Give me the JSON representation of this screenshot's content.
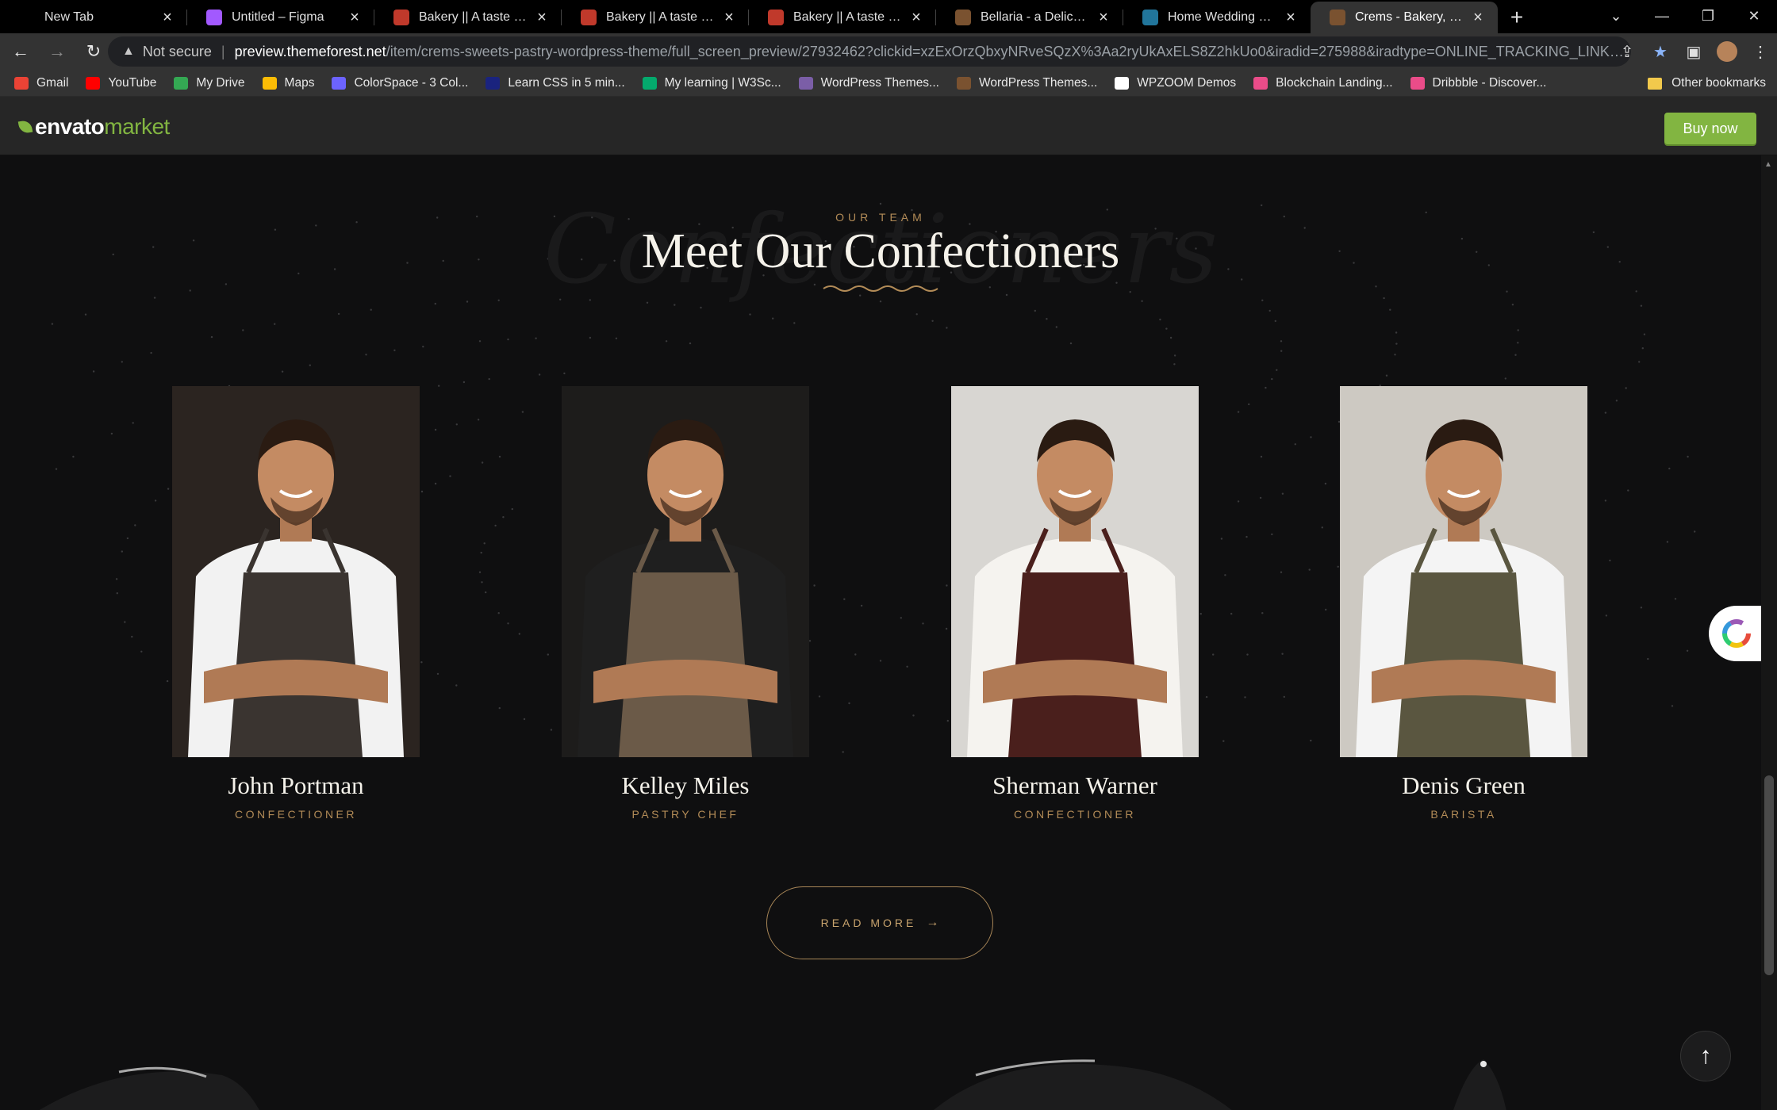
{
  "browser": {
    "tabs": [
      {
        "title": "New Tab",
        "icon": "chrome-icon",
        "color": "#000000"
      },
      {
        "title": "Untitled – Figma",
        "icon": "figma-icon",
        "color": "#a259ff"
      },
      {
        "title": "Bakery || A taste of paradise",
        "icon": "cake-icon",
        "color": "#c0392b"
      },
      {
        "title": "Bakery || A taste of paradise",
        "icon": "cake-icon",
        "color": "#c0392b"
      },
      {
        "title": "Bakery || A taste of paradise",
        "icon": "cake-icon",
        "color": "#c0392b"
      },
      {
        "title": "Bellaria - a Delicious Cake",
        "icon": "bellaria-icon",
        "color": "#7a5230"
      },
      {
        "title": "Home Wedding – Bellaria",
        "icon": "wordpress-icon",
        "color": "#21759b"
      },
      {
        "title": "Crems - Bakery, Chocolate",
        "icon": "crems-icon",
        "color": "#7a5230"
      }
    ],
    "address": {
      "security": "Not secure",
      "domain": "preview.themeforest.net",
      "path": "/item/crems-sweets-pastry-wordpress-theme/full_screen_preview/27932462?clickid=xzExOrzQbxyNRveSQzX%3Aa2ryUkAxELS8Z2hkUo0&iradid=275988&iradtype=ONLINE_TRACKING_LINK&irgwc=1..."
    },
    "bookmarks": [
      {
        "label": "Gmail",
        "color": "#ea4335"
      },
      {
        "label": "YouTube",
        "color": "#ff0000"
      },
      {
        "label": "My Drive",
        "color": "#34a853"
      },
      {
        "label": "Maps",
        "color": "#fbbc05"
      },
      {
        "label": "ColorSpace - 3 Col...",
        "color": "#6c63ff"
      },
      {
        "label": "Learn CSS in 5 min...",
        "color": "#1a237e"
      },
      {
        "label": "My learning | W3Sc...",
        "color": "#04aa6d"
      },
      {
        "label": "WordPress Themes...",
        "color": "#7b5ea7"
      },
      {
        "label": "WordPress Themes...",
        "color": "#7a5230"
      },
      {
        "label": "WPZOOM Demos",
        "color": "#ffffff"
      },
      {
        "label": "Blockchain Landing...",
        "color": "#ea4c89"
      },
      {
        "label": "Dribbble - Discover...",
        "color": "#ea4c89"
      }
    ],
    "bookmarks_more": "»",
    "other_bookmarks": "Other bookmarks"
  },
  "envato": {
    "logo_word1": "envato",
    "logo_word2": "market",
    "buy_label": "Buy now"
  },
  "section": {
    "eyebrow": "OUR TEAM",
    "script_bg": "Confectioners",
    "title": "Meet Our Confectioners",
    "team": [
      {
        "name": "John Portman",
        "role": "CONFECTIONER",
        "apron": "#3a3430",
        "shirt": "#f2f2f2",
        "bg": "#2b2420"
      },
      {
        "name": "Kelley Miles",
        "role": "PASTRY CHEF",
        "apron": "#6b5a48",
        "shirt": "#1f1f1f",
        "bg": "#1d1c1b"
      },
      {
        "name": "Sherman Warner",
        "role": "CONFECTIONER",
        "apron": "#4a1f1c",
        "shirt": "#f5f3ef",
        "bg": "#d8d6d2"
      },
      {
        "name": "Denis Green",
        "role": "BARISTA",
        "apron": "#5a5640",
        "shirt": "#f4f4f4",
        "bg": "#cdc9c2"
      }
    ],
    "read_more": "READ MORE",
    "read_more_arrow": "→"
  },
  "colors": {
    "accent_gold": "#b28b57",
    "envato_green": "#82b541",
    "page_bg": "#0f0f10"
  },
  "icons": {
    "back_to_top": "arrow-up-icon",
    "color_switcher": "color-wheel-icon"
  }
}
